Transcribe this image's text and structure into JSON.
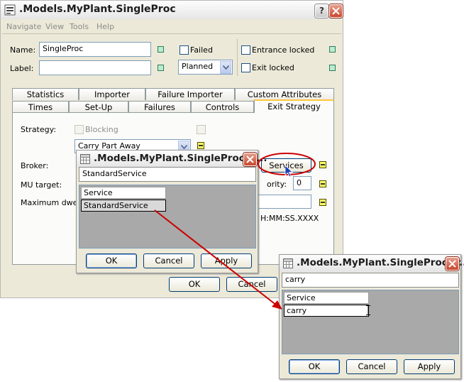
{
  "main": {
    "title": ".Models.MyPlant.SingleProc",
    "help_glyph": "?",
    "menu": [
      "Navigate",
      "View",
      "Tools",
      "Help"
    ],
    "name_label": "Name:",
    "name_value": "SingleProc",
    "label_label": "Label:",
    "label_value": "",
    "failed_label": "Failed",
    "planned_value": "Planned",
    "entrance_locked_label": "Entrance locked",
    "exit_locked_label": "Exit locked",
    "tabs_row1": [
      "Statistics",
      "Importer",
      "Failure Importer",
      "Custom Attributes"
    ],
    "tabs_row2": [
      "Times",
      "Set-Up",
      "Failures",
      "Controls",
      "Exit Strategy"
    ],
    "strategy_label": "Strategy:",
    "blocking_label": "Blocking",
    "strategy_value": "Carry Part Away",
    "broker_label": "Broker:",
    "services_button": "Services",
    "mu_target_label": "MU target:",
    "priority_label": "ority:",
    "priority_value": "0",
    "max_dwell_label": "Maximum dwell t",
    "time_format": "H:MM:SS.XXXX",
    "ok": "OK",
    "cancel": "Cancel"
  },
  "dialog1": {
    "title": ".Models.MyPlant.SingleProc.tr...",
    "input_value": "StandardService",
    "rows": [
      {
        "col1": "Service"
      },
      {
        "col1": "StandardService"
      }
    ],
    "ok": "OK",
    "cancel": "Cancel",
    "apply": "Apply"
  },
  "dialog2": {
    "title": ".Models.MyPlant.SingleProc.tr...",
    "input_value": "carry",
    "rows": [
      {
        "col1": "Service"
      },
      {
        "col1": "carry"
      }
    ],
    "ok": "OK",
    "cancel": "Cancel",
    "apply": "Apply"
  },
  "colors": {
    "annotation": "#cc0000",
    "window_bg": "#ece9d8",
    "tab_highlight": "#ffc73c"
  }
}
